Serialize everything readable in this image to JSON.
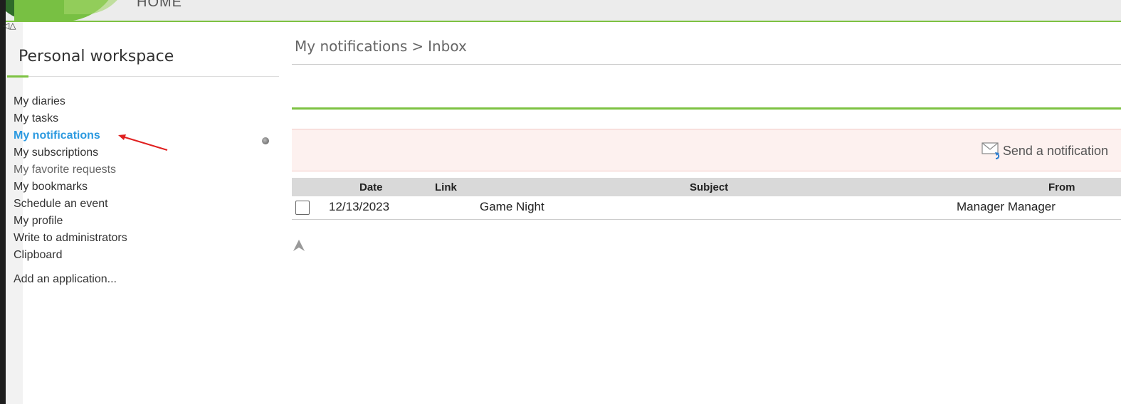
{
  "header": {
    "home_label": "HOME"
  },
  "sidebar": {
    "title": "Personal workspace",
    "items": [
      {
        "label": "My diaries"
      },
      {
        "label": "My tasks"
      },
      {
        "label": "My notifications"
      },
      {
        "label": "My subscriptions"
      },
      {
        "label": "My favorite requests"
      },
      {
        "label": "My bookmarks"
      },
      {
        "label": "Schedule an event"
      },
      {
        "label": "My profile"
      },
      {
        "label": "Write to administrators"
      },
      {
        "label": "Clipboard"
      }
    ],
    "add_application": "Add an application..."
  },
  "breadcrumb": {
    "parent": "My notifications",
    "separator": ">",
    "current": "Inbox"
  },
  "actions": {
    "send_notification": "Send a notification"
  },
  "table": {
    "columns": [
      "Date",
      "Link",
      "Subject",
      "From"
    ],
    "rows": [
      {
        "date": "12/13/2023",
        "link": "",
        "subject": "Game Night",
        "from": "Manager Manager"
      }
    ]
  },
  "colors": {
    "accent": "#7dc242",
    "active_link": "#2d9ae0",
    "annotation": "#e02020"
  },
  "icons": [
    "gear-icon",
    "envelope-icon",
    "collapse-icon",
    "scroll-top-icon"
  ]
}
